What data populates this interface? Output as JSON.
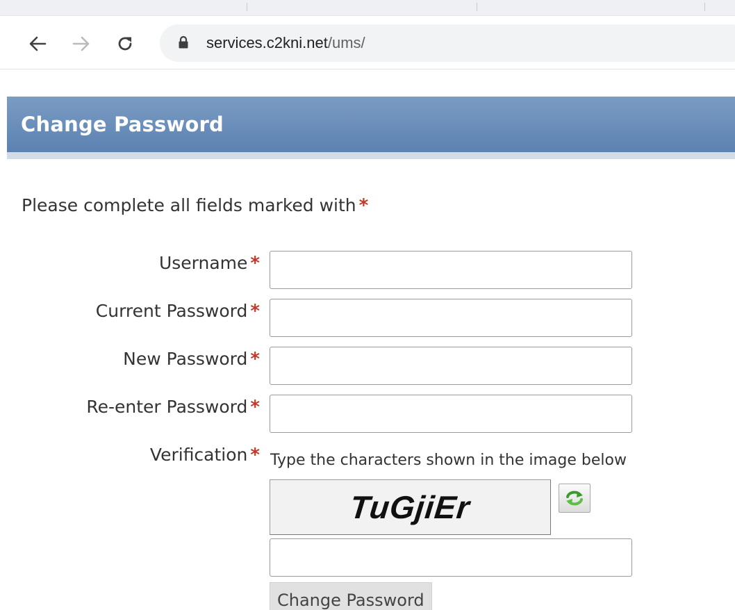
{
  "browser": {
    "url_host": "services.c2kni.net",
    "url_path": "/ums/",
    "icons": {
      "back": "back-arrow-icon",
      "forward": "forward-arrow-icon",
      "reload": "reload-icon",
      "secure": "lock-icon"
    }
  },
  "header": {
    "title": "Change Password"
  },
  "form": {
    "instructions": "Please complete all fields marked with",
    "required_marker": "*",
    "fields": {
      "username": {
        "label": "Username",
        "value": ""
      },
      "current_password": {
        "label": "Current Password",
        "value": ""
      },
      "new_password": {
        "label": "New Password",
        "value": ""
      },
      "reenter_password": {
        "label": "Re-enter Password",
        "value": ""
      },
      "verification": {
        "label": "Verification",
        "value": ""
      }
    },
    "captcha": {
      "hint": "Type the characters shown in the image below",
      "text": "TuGjiEr",
      "refresh_icon": "refresh-icon"
    },
    "submit_label": "Change Password"
  },
  "colors": {
    "header_bg": "#6a8dba",
    "header_text": "#ffffff",
    "required": "#c0392b",
    "refresh_green": "#3c9a2c"
  }
}
